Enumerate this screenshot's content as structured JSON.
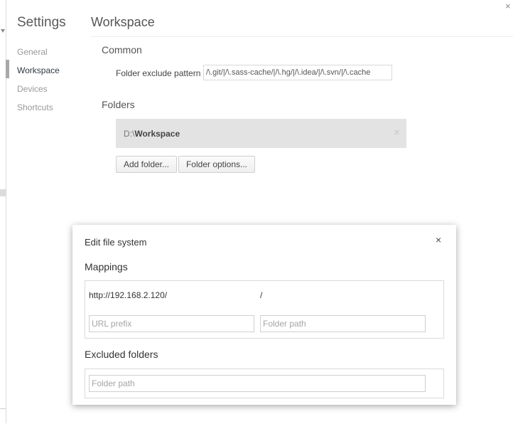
{
  "sidebar": {
    "title": "Settings",
    "items": [
      {
        "label": "General"
      },
      {
        "label": "Workspace"
      },
      {
        "label": "Devices"
      },
      {
        "label": "Shortcuts"
      }
    ],
    "selected": "Workspace"
  },
  "window": {
    "close_glyph": "×"
  },
  "workspace": {
    "title": "Workspace",
    "common": {
      "heading": "Common",
      "exclude_label": "Folder exclude pattern",
      "exclude_value": "/\\.git/|/\\.sass-cache/|/\\.hg/|/\\.idea/|/\\.svn/|/\\.cache"
    },
    "folders": {
      "heading": "Folders",
      "items": [
        {
          "prefix": "D:\\",
          "name": "Workspace",
          "remove_glyph": "×"
        }
      ],
      "add_button": "Add folder...",
      "options_button": "Folder options..."
    }
  },
  "dialog": {
    "title": "Edit file system",
    "close_glyph": "×",
    "mappings": {
      "heading": "Mappings",
      "rows": [
        {
          "url": "http://192.168.2.120/",
          "path": "/"
        }
      ],
      "url_placeholder": "URL prefix",
      "path_placeholder": "Folder path"
    },
    "excluded": {
      "heading": "Excluded folders",
      "path_placeholder": "Folder path"
    }
  }
}
